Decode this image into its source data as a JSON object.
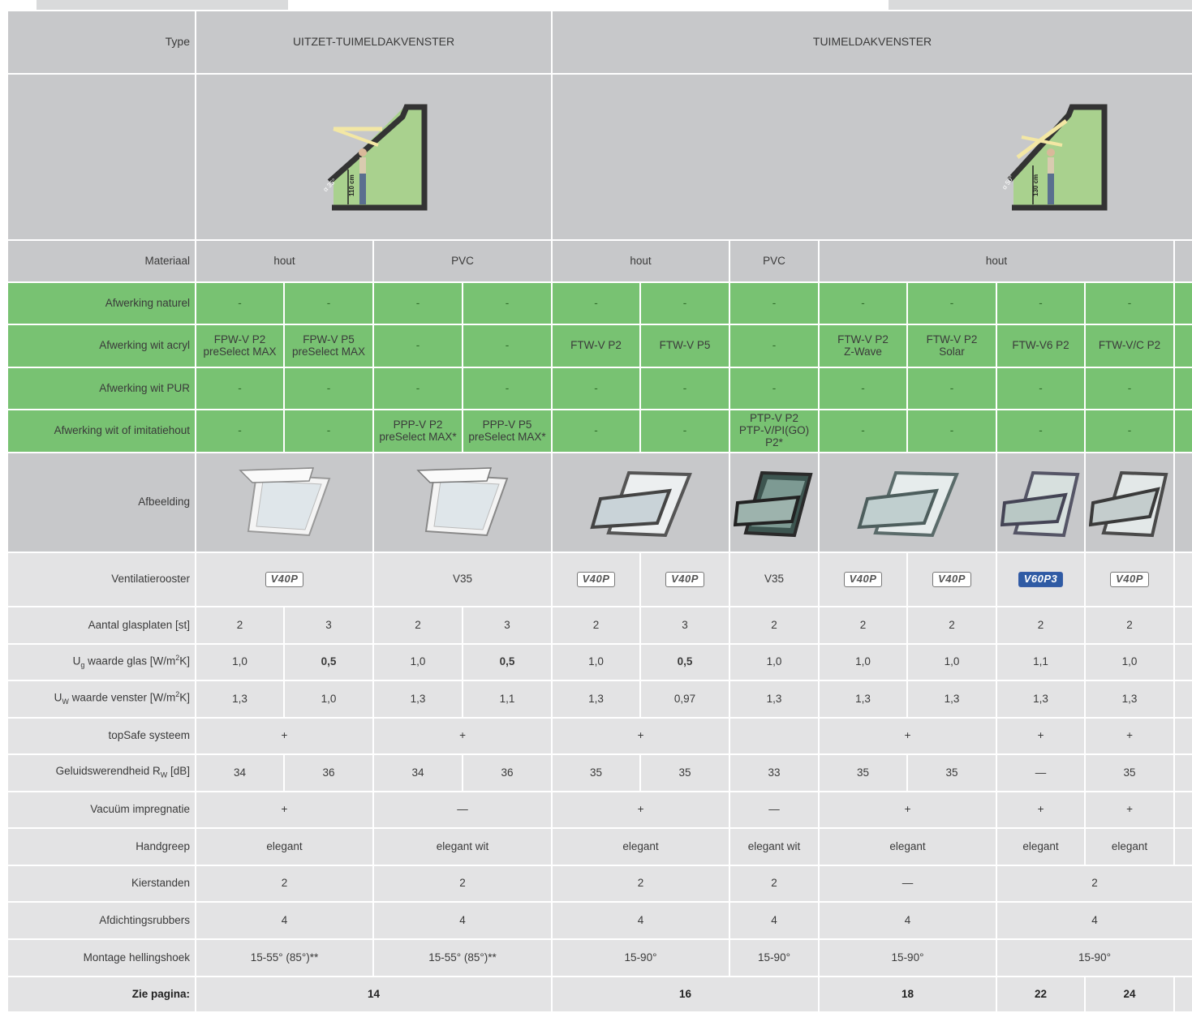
{
  "header": {
    "type_label": "Type",
    "group1": "UITZET-TUIMELDAKVENSTER",
    "group2": "TUIMELDAKVENSTER",
    "diagram1": {
      "angle": "α 35°",
      "height": "110 cm"
    },
    "diagram2": {
      "angle": "α 50°",
      "height": "130 cm"
    }
  },
  "labels": {
    "materiaal": "Materiaal",
    "naturel": "Afwerking naturel",
    "acryl": "Afwerking wit acryl",
    "pur": "Afwerking wit PUR",
    "imitatie": "Afwerking wit of imitatiehout",
    "afbeelding": "Afbeelding",
    "ventilatie": "Ventilatierooster",
    "glasplaten": "Aantal glasplaten [st]",
    "ug_main": "U",
    "ug_sub": "g",
    "ug_rest": " waarde glas [W/m",
    "ug_sup": "2",
    "ug_end": "K]",
    "uw_main": "U",
    "uw_sub": "W",
    "uw_rest": " waarde venster [W/m",
    "uw_sup": "2",
    "uw_end": "K]",
    "topsafe": "topSafe systeem",
    "geluid_main": "Geluidswerendheid R",
    "geluid_sub": "W",
    "geluid_end": " [dB]",
    "vacuum": "Vacuüm impregnatie",
    "handgreep": "Handgreep",
    "kierstanden": "Kierstanden",
    "rubbers": "Afdichtingsrubbers",
    "montage": "Montage hellingshoek",
    "pagina": "Zie pagina:"
  },
  "materiaal": {
    "c1": "hout",
    "c2": "PVC",
    "c3": "hout",
    "c4": "PVC",
    "c5": "hout"
  },
  "dash": "-",
  "acryl": {
    "c1a": "FPW-V P2",
    "c1b": "preSelect MAX",
    "c2a": "FPW-V P5",
    "c2b": "preSelect MAX",
    "c5": "FTW-V P2",
    "c6": "FTW-V P5",
    "c8a": "FTW-V P2",
    "c8b": "Z-Wave",
    "c9a": "FTW-V P2",
    "c9b": "Solar",
    "c10": "FTW-V6 P2",
    "c11": "FTW-V/C P2"
  },
  "imitatie": {
    "c3a": "PPP-V P2",
    "c3b": "preSelect MAX*",
    "c4a": "PPP-V P5",
    "c4b": "preSelect MAX*",
    "c7a": "PTP-V P2",
    "c7b": "PTP-V/PI(GO) P2*"
  },
  "ventilatie": {
    "v40": "V40P",
    "v35a": "V35",
    "v35b": "V35",
    "v60": "V60P3"
  },
  "glasplaten": [
    "2",
    "3",
    "2",
    "3",
    "2",
    "3",
    "2",
    "2",
    "2",
    "2",
    "2"
  ],
  "ug": [
    "1,0",
    "0,5",
    "1,0",
    "0,5",
    "1,0",
    "0,5",
    "1,0",
    "1,0",
    "1,0",
    "1,1",
    "1,0"
  ],
  "uw": [
    "1,3",
    "1,0",
    "1,3",
    "1,1",
    "1,3",
    "0,97",
    "1,3",
    "1,3",
    "1,3",
    "1,3",
    "1,3"
  ],
  "topsafe": {
    "c1": "+",
    "c2": "+",
    "c3": "+",
    "c4": "",
    "c5": "+",
    "c6": "+",
    "c7": "+"
  },
  "geluid": [
    "34",
    "36",
    "34",
    "36",
    "35",
    "35",
    "33",
    "35",
    "35",
    "—",
    "35"
  ],
  "vacuum": {
    "c1": "+",
    "c2": "—",
    "c3": "+",
    "c4": "—",
    "c5": "+",
    "c6": "+",
    "c7": "+"
  },
  "handgreep": {
    "c1": "elegant",
    "c2": "elegant wit",
    "c3": "elegant",
    "c4": "elegant wit",
    "c5": "elegant",
    "c6": "elegant",
    "c7": "elegant"
  },
  "kierstanden": {
    "c1": "2",
    "c2": "2",
    "c3": "2",
    "c4": "2",
    "c5": "—",
    "c6": "2"
  },
  "rubbers": {
    "c1": "4",
    "c2": "4",
    "c3": "4",
    "c4": "4",
    "c5": "4",
    "c6": "4"
  },
  "montage": {
    "c1": "15-55° (85°)**",
    "c2": "15-55° (85°)**",
    "c3": "15-90°",
    "c4": "15-90°",
    "c5": "15-90°",
    "c6": "15-90°"
  },
  "pagina": {
    "c1": "14",
    "c2": "16",
    "c3": "18",
    "c4": "22",
    "c5": "24"
  }
}
